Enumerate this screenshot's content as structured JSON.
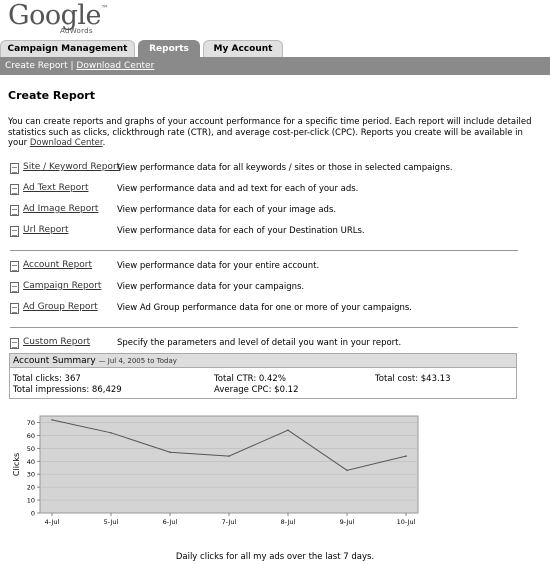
{
  "logo": {
    "word": "Google",
    "tm": "™",
    "sub": "AdWords"
  },
  "tabs": [
    {
      "label": "Campaign Management",
      "active": false
    },
    {
      "label": "Reports",
      "active": true
    },
    {
      "label": "My Account",
      "active": false
    }
  ],
  "subnav": {
    "current": "Create Report",
    "separator": "|",
    "link": "Download Center"
  },
  "page_title": "Create Report",
  "intro": {
    "text": "You can create reports and graphs of your account performance for a specific time period. Each report will include detailed statistics such as clicks, clickthrough rate (CTR), and average cost-per-click (CPC). Reports you create will be available in your ",
    "link": "Download Center",
    "end": "."
  },
  "report_groups": [
    [
      {
        "link": "Site / Keyword Report",
        "desc": "View performance data for all keywords / sites or those in selected campaigns."
      },
      {
        "link": "Ad Text Report",
        "desc": "View performance data and ad text for each of your ads."
      },
      {
        "link": "Ad Image Report",
        "desc": "View performance data for each of your image ads."
      },
      {
        "link": "Url Report",
        "desc": "View performance data for each of your Destination URLs."
      }
    ],
    [
      {
        "link": "Account Report",
        "desc": "View performance data for your entire account."
      },
      {
        "link": "Campaign Report",
        "desc": "View performance data for your campaigns."
      },
      {
        "link": "Ad Group Report",
        "desc": "View Ad Group performance data for one or more of your campaigns."
      }
    ],
    [
      {
        "link": "Custom Report",
        "desc": "Specify the parameters and level of detail you want in your report."
      }
    ]
  ],
  "account_summary": {
    "title": "Account Summary",
    "date_range": "— Jul 4, 2005 to Today",
    "total_clicks": "Total clicks: 367",
    "total_impressions": "Total impressions: 86,429",
    "total_ctr": "Total CTR: 0.42%",
    "avg_cpc": "Average CPC: $0.12",
    "total_cost": "Total cost: $43.13"
  },
  "chart_data": {
    "type": "line",
    "categories": [
      "4-Jul",
      "5-Jul",
      "6-Jul",
      "7-Jul",
      "8-Jul",
      "9-Jul",
      "10-Jul"
    ],
    "values": [
      72,
      62,
      47,
      44,
      64,
      33,
      44
    ],
    "ylabel": "Clicks",
    "ylim": [
      0,
      75
    ],
    "yticks": [
      0,
      10,
      20,
      30,
      40,
      50,
      60,
      70
    ],
    "grid": true,
    "colors": {
      "plot_bg": "#d4d4d4",
      "line": "#555555",
      "grid": "#bbbbbb"
    }
  },
  "caption": "Daily clicks for all my ads over the last 7 days."
}
